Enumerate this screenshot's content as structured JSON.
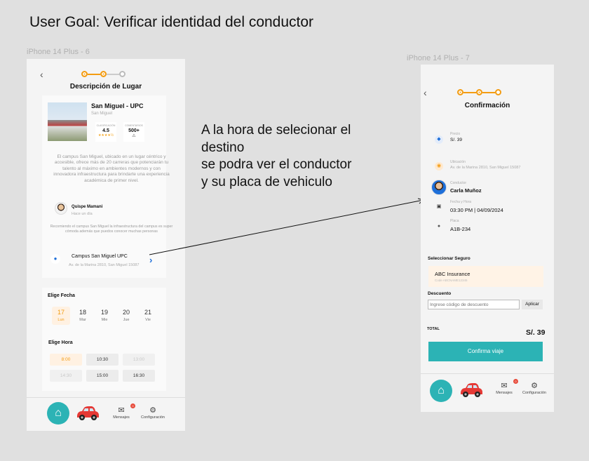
{
  "goal": "User Goal: Verificar identidad del conductor",
  "frames": {
    "left_label": "iPhone 14 Plus - 6",
    "right_label": "iPhone 14 Plus - 7"
  },
  "colors": {
    "accent": "#f39c12",
    "teal": "#2cb3b5",
    "link": "#1e6fd9",
    "badge": "#e74c3c",
    "car": "#e53935"
  },
  "screen6": {
    "back": "‹",
    "title": "Descripción de Lugar",
    "place": {
      "name": "San Miguel - UPC",
      "district": "San Miguel",
      "rating_label": "CLASIFICACIÓN",
      "rating": "4.5",
      "stars": "★★★★½",
      "comments_label": "COMENTARIOS",
      "comments": "500+"
    },
    "description": "El campus San Miguel, ubicado en un lugar céntrico y accesible, ofrece más de 20 carreras que potenciarán tu talento al máximo en ambientes modernos y con innovadora infraestructura para brindarte una experiencia académica de primer nivel.",
    "review": {
      "name": "Quispe Mamani",
      "time": "Hace un día",
      "text": "Recomiendo el campus San Miguel la infraestructura del campus es super cómoda además que puedos conocer muchas personas"
    },
    "location": {
      "name": "Campus San Miguel UPC",
      "address": "Av. de la Marina 2810, San Miguel 15087"
    },
    "date_title": "Elige Fecha",
    "days": [
      {
        "num": "17",
        "wd": "Lun"
      },
      {
        "num": "18",
        "wd": "Mar"
      },
      {
        "num": "19",
        "wd": "Mie"
      },
      {
        "num": "20",
        "wd": "Jue"
      },
      {
        "num": "21",
        "wd": "Vie"
      }
    ],
    "hour_title": "Elige Hora",
    "hours": [
      "8:00",
      "10:30",
      "13:00",
      "14:30",
      "15:00",
      "16:30"
    ],
    "nav": {
      "messages": "Mensajes",
      "settings": "Configuración",
      "badge": "0"
    }
  },
  "annotation": {
    "lines": [
      "A la hora de selecionar el",
      "destino",
      "se podra ver el conductor",
      "y su placa de vehiculo"
    ]
  },
  "screen7": {
    "back": "‹",
    "title": "Confirmación",
    "price_label": "Precio",
    "price": "S/. 39",
    "location_label": "Ubicación",
    "location": "Av. de la Marina 2810, San Miguel 15087",
    "driver_label": "Conductor",
    "driver": "Carla Muñoz",
    "datetime_label": "Fecha y Hora",
    "datetime": "03:30 PM | 04/09/2024",
    "plate_label": "Placa",
    "plate": "A1B-234",
    "insurance_title": "Seleccionar Seguro",
    "insurance_name": "ABC Insurance",
    "insurance_code": "Code ABCNAME12345",
    "discount_title": "Descuento",
    "discount_placeholder": "Ingrese código de descuento",
    "apply": "Aplicar",
    "total_label": "TOTAL",
    "total": "S/. 39",
    "confirm": "Confirma viaje",
    "nav": {
      "messages": "Mensajes",
      "settings": "Configuración",
      "badge": "0"
    }
  }
}
